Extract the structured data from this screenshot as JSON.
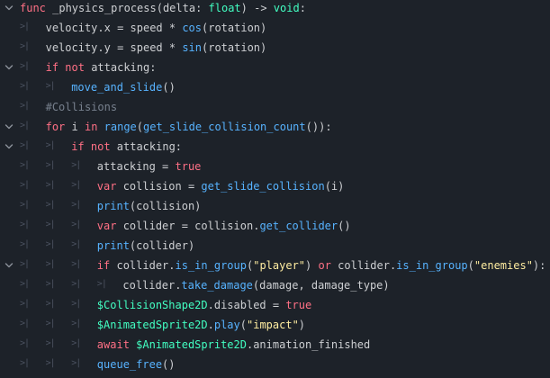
{
  "editor": {
    "theme_colors": {
      "background": "#1d2229",
      "text": "#cdcfd2",
      "keyword": "#ff7085",
      "function": "#57b3ff",
      "builtin": "#42ffc2",
      "string": "#ffeda1",
      "comment": "#77808d",
      "guide": "#4b5260",
      "fold_arrow": "#8b919a"
    },
    "lines": [
      {
        "indent": 0,
        "fold": true,
        "tokens": [
          {
            "t": "func",
            "c": "keyword"
          },
          {
            "t": " _physics_process(delta: ",
            "c": "text"
          },
          {
            "t": "float",
            "c": "type"
          },
          {
            "t": ") -> ",
            "c": "text"
          },
          {
            "t": "void",
            "c": "type"
          },
          {
            "t": ":",
            "c": "text"
          }
        ]
      },
      {
        "indent": 1,
        "fold": false,
        "tokens": [
          {
            "t": "velocity.x = speed * ",
            "c": "text"
          },
          {
            "t": "cos",
            "c": "fn"
          },
          {
            "t": "(rotation)",
            "c": "text"
          }
        ]
      },
      {
        "indent": 1,
        "fold": false,
        "tokens": [
          {
            "t": "velocity.y = speed * ",
            "c": "text"
          },
          {
            "t": "sin",
            "c": "fn"
          },
          {
            "t": "(rotation)",
            "c": "text"
          }
        ]
      },
      {
        "indent": 1,
        "fold": true,
        "tokens": [
          {
            "t": "if",
            "c": "keyword"
          },
          {
            "t": " ",
            "c": "text"
          },
          {
            "t": "not",
            "c": "keyword"
          },
          {
            "t": " attacking:",
            "c": "text"
          }
        ]
      },
      {
        "indent": 2,
        "fold": false,
        "tokens": [
          {
            "t": "move_and_slide",
            "c": "fn"
          },
          {
            "t": "()",
            "c": "text"
          }
        ]
      },
      {
        "indent": 1,
        "fold": false,
        "tokens": [
          {
            "t": "#Collisions",
            "c": "comment"
          }
        ]
      },
      {
        "indent": 1,
        "fold": true,
        "tokens": [
          {
            "t": "for",
            "c": "keyword"
          },
          {
            "t": " i ",
            "c": "text"
          },
          {
            "t": "in",
            "c": "keyword"
          },
          {
            "t": " ",
            "c": "text"
          },
          {
            "t": "range",
            "c": "fn"
          },
          {
            "t": "(",
            "c": "text"
          },
          {
            "t": "get_slide_collision_count",
            "c": "fn"
          },
          {
            "t": "()):",
            "c": "text"
          }
        ]
      },
      {
        "indent": 2,
        "fold": true,
        "tokens": [
          {
            "t": "if",
            "c": "keyword"
          },
          {
            "t": " ",
            "c": "text"
          },
          {
            "t": "not",
            "c": "keyword"
          },
          {
            "t": " attacking:",
            "c": "text"
          }
        ]
      },
      {
        "indent": 3,
        "fold": false,
        "tokens": [
          {
            "t": "attacking = ",
            "c": "text"
          },
          {
            "t": "true",
            "c": "literal"
          }
        ]
      },
      {
        "indent": 3,
        "fold": false,
        "tokens": [
          {
            "t": "var",
            "c": "keyword"
          },
          {
            "t": " collision = ",
            "c": "text"
          },
          {
            "t": "get_slide_collision",
            "c": "fn"
          },
          {
            "t": "(i)",
            "c": "text"
          }
        ]
      },
      {
        "indent": 3,
        "fold": false,
        "tokens": [
          {
            "t": "print",
            "c": "fn"
          },
          {
            "t": "(collision)",
            "c": "text"
          }
        ]
      },
      {
        "indent": 3,
        "fold": false,
        "tokens": [
          {
            "t": "var",
            "c": "keyword"
          },
          {
            "t": " collider = collision.",
            "c": "text"
          },
          {
            "t": "get_collider",
            "c": "fn"
          },
          {
            "t": "()",
            "c": "text"
          }
        ]
      },
      {
        "indent": 3,
        "fold": false,
        "tokens": [
          {
            "t": "print",
            "c": "fn"
          },
          {
            "t": "(collider)",
            "c": "text"
          }
        ]
      },
      {
        "indent": 3,
        "fold": true,
        "tokens": [
          {
            "t": "if",
            "c": "keyword"
          },
          {
            "t": " collider.",
            "c": "text"
          },
          {
            "t": "is_in_group",
            "c": "fn"
          },
          {
            "t": "(",
            "c": "text"
          },
          {
            "t": "\"player\"",
            "c": "string"
          },
          {
            "t": ") ",
            "c": "text"
          },
          {
            "t": "or",
            "c": "keyword"
          },
          {
            "t": " collider.",
            "c": "text"
          },
          {
            "t": "is_in_group",
            "c": "fn"
          },
          {
            "t": "(",
            "c": "text"
          },
          {
            "t": "\"enemies\"",
            "c": "string"
          },
          {
            "t": "):",
            "c": "text"
          }
        ]
      },
      {
        "indent": 4,
        "fold": false,
        "tokens": [
          {
            "t": "collider.",
            "c": "text"
          },
          {
            "t": "take_damage",
            "c": "fn"
          },
          {
            "t": "(damage, damage_type)",
            "c": "text"
          }
        ]
      },
      {
        "indent": 3,
        "fold": false,
        "tokens": [
          {
            "t": "$CollisionShape2D",
            "c": "builtin"
          },
          {
            "t": ".disabled = ",
            "c": "text"
          },
          {
            "t": "true",
            "c": "literal"
          }
        ]
      },
      {
        "indent": 3,
        "fold": false,
        "tokens": [
          {
            "t": "$AnimatedSprite2D",
            "c": "builtin"
          },
          {
            "t": ".",
            "c": "text"
          },
          {
            "t": "play",
            "c": "fn"
          },
          {
            "t": "(",
            "c": "text"
          },
          {
            "t": "\"impact\"",
            "c": "string"
          },
          {
            "t": ")",
            "c": "text"
          }
        ]
      },
      {
        "indent": 3,
        "fold": false,
        "tokens": [
          {
            "t": "await",
            "c": "keyword"
          },
          {
            "t": " ",
            "c": "text"
          },
          {
            "t": "$AnimatedSprite2D",
            "c": "builtin"
          },
          {
            "t": ".animation_finished",
            "c": "text"
          }
        ]
      },
      {
        "indent": 3,
        "fold": false,
        "tokens": [
          {
            "t": "queue_free",
            "c": "fn"
          },
          {
            "t": "()",
            "c": "text"
          }
        ]
      }
    ]
  }
}
